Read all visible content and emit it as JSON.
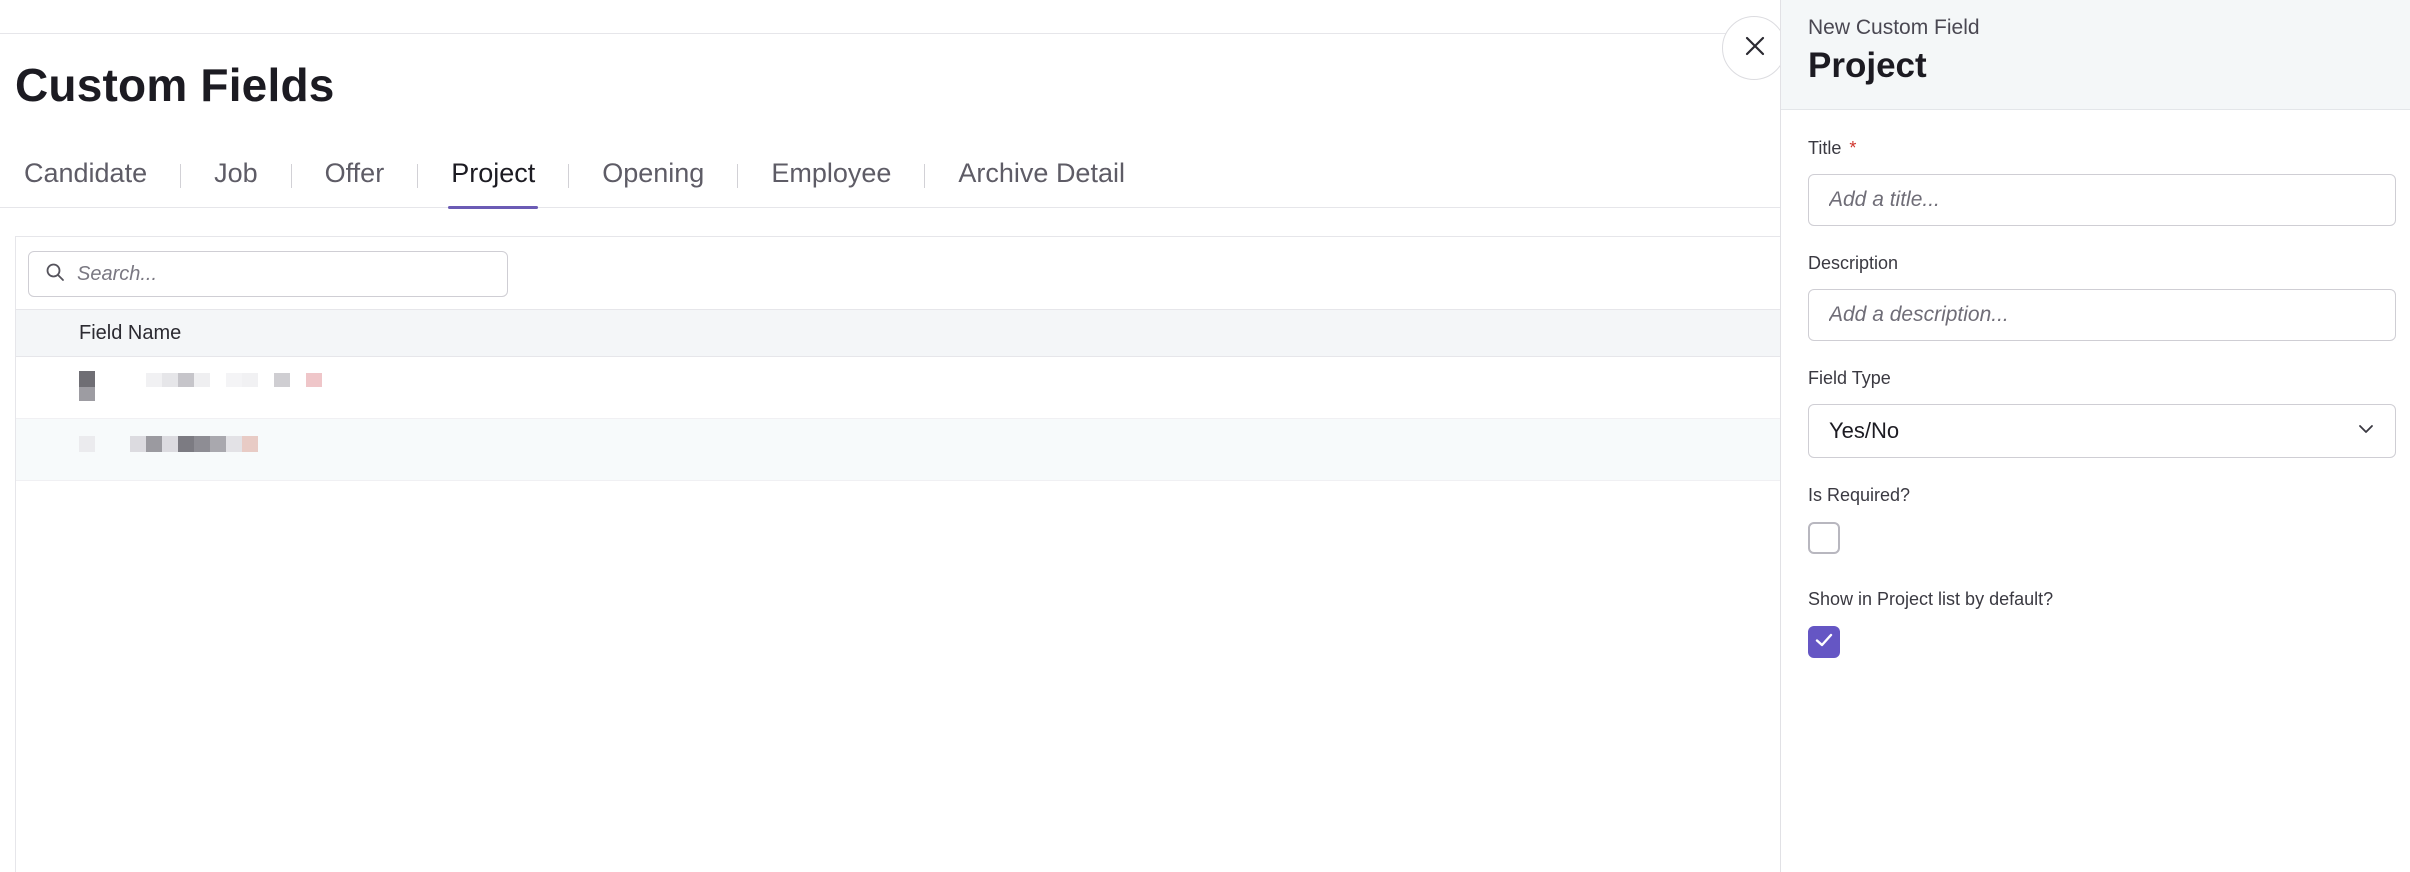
{
  "page": {
    "title": "Custom Fields"
  },
  "tabs": [
    {
      "label": "Candidate"
    },
    {
      "label": "Job"
    },
    {
      "label": "Offer"
    },
    {
      "label": "Project",
      "active": true
    },
    {
      "label": "Opening"
    },
    {
      "label": "Employee"
    },
    {
      "label": "Archive Detail"
    }
  ],
  "search": {
    "placeholder": "Search..."
  },
  "table": {
    "column_field_name": "Field Name"
  },
  "panel": {
    "subtitle": "New Custom Field",
    "title": "Project",
    "title_label": "Title",
    "required_mark": "*",
    "title_placeholder": "Add a title...",
    "description_label": "Description",
    "description_placeholder": "Add a description...",
    "field_type_label": "Field Type",
    "field_type_value": "Yes/No",
    "is_required_label": "Is Required?",
    "is_required_checked": false,
    "show_in_list_label": "Show in Project list by default?",
    "show_in_list_checked": true
  },
  "icons": {
    "search": "search-icon",
    "close": "close-icon",
    "chevron": "chevron-down-icon",
    "check": "check-icon"
  },
  "colors": {
    "accent": "#6556c4",
    "tab_underline": "#6b5bb5",
    "required": "#d0342c"
  }
}
